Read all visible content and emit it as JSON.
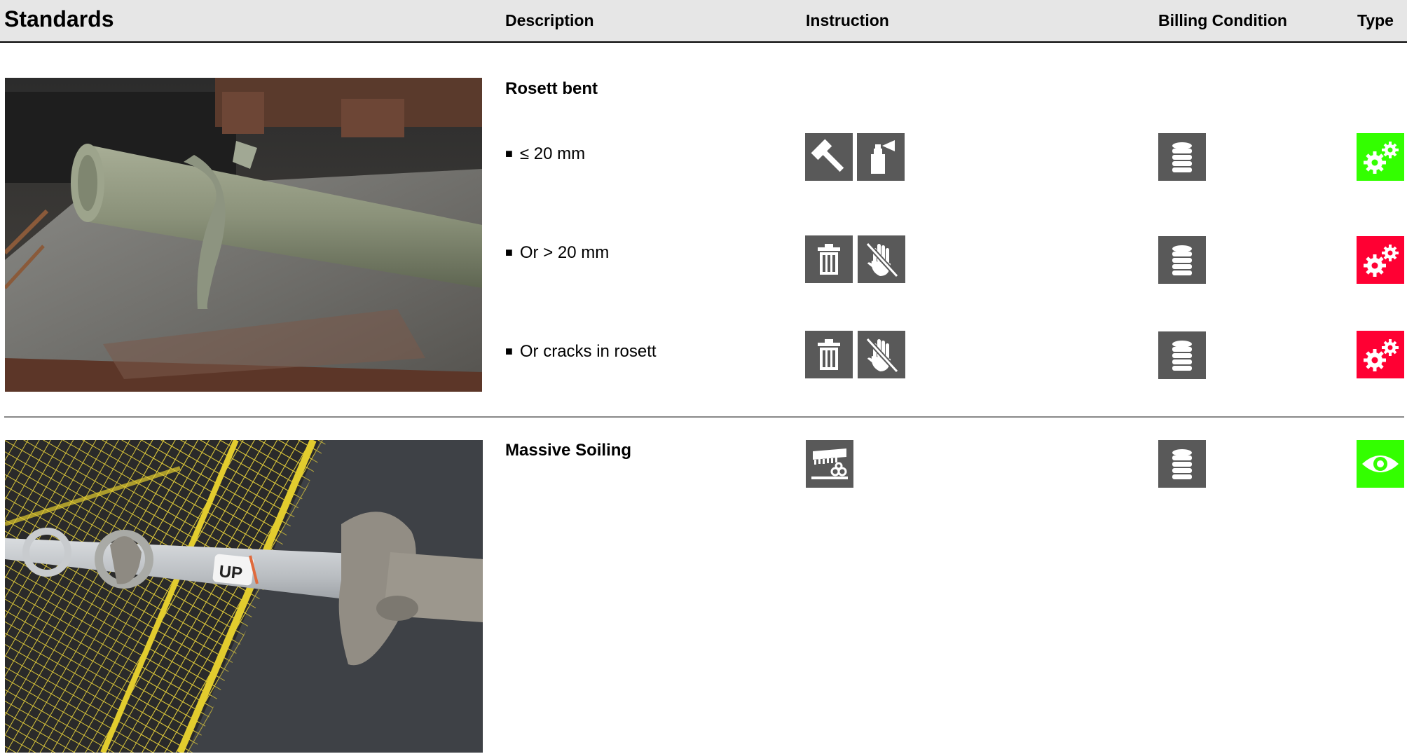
{
  "header": {
    "standards": "Standards",
    "description": "Description",
    "instruction": "Instruction",
    "billing": "Billing Condition",
    "type": "Type"
  },
  "colors": {
    "accept": "#33ff00",
    "reject": "#ff0033",
    "tile": "#595959",
    "header_bg": "#e6e6e6"
  },
  "sections": [
    {
      "title": "Rosett bent",
      "items": [
        {
          "bullet": "■",
          "text": "≤ 20 mm",
          "instructions": [
            "hammer-icon",
            "spray-can-icon"
          ],
          "billing": "coin-stack-icon",
          "type": "gears-icon",
          "status": "accept"
        },
        {
          "bullet": "■",
          "text": "Or > 20 mm",
          "instructions": [
            "trash-icon",
            "no-touch-hand-icon"
          ],
          "billing": "coin-stack-icon",
          "type": "gears-icon",
          "status": "reject"
        },
        {
          "bullet": "■",
          "text": "Or cracks in rosett",
          "instructions": [
            "trash-icon",
            "no-touch-hand-icon"
          ],
          "billing": "coin-stack-icon",
          "type": "gears-icon",
          "status": "reject"
        }
      ]
    },
    {
      "title": "Massive Soiling",
      "items": [
        {
          "instructions": [
            "cleaning-machine-icon"
          ],
          "billing": "coin-stack-icon",
          "type": "eye-icon",
          "status": "accept"
        }
      ]
    }
  ]
}
